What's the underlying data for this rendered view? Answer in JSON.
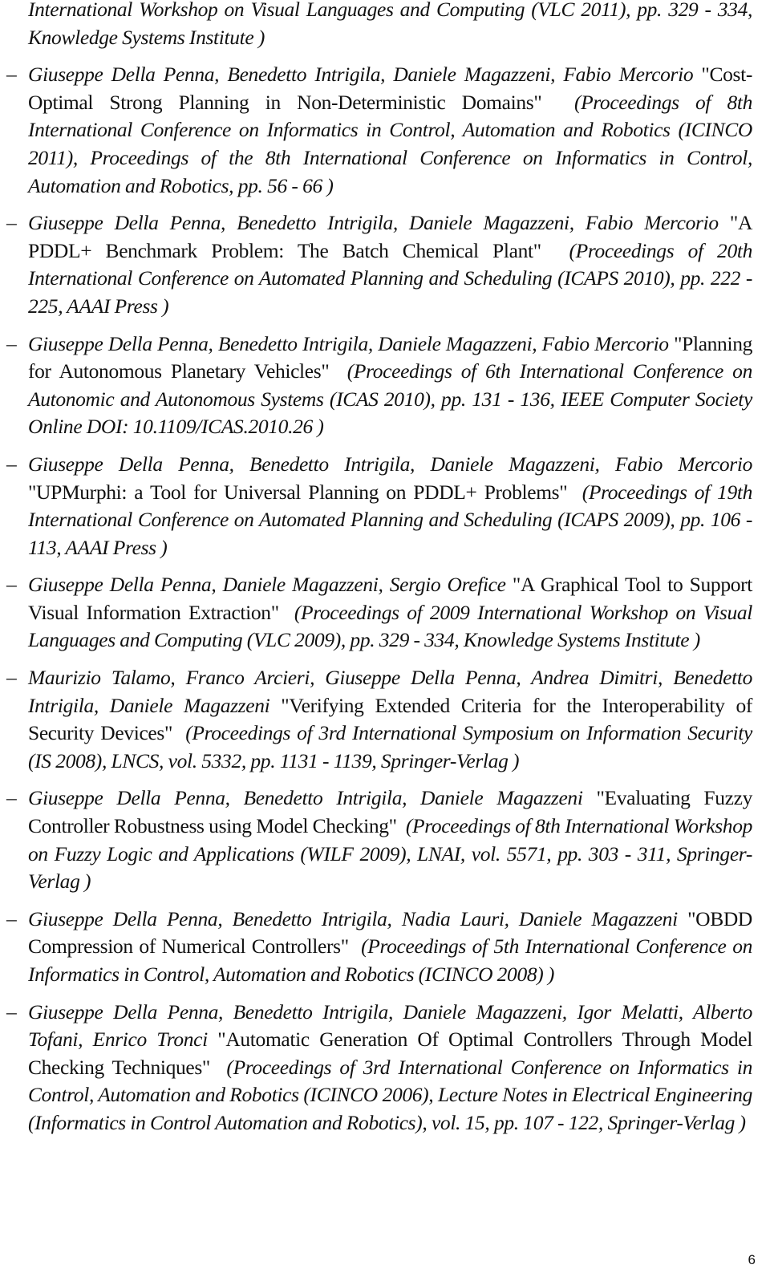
{
  "continuation": {
    "venue": "International Workshop on Visual Languages and Computing (VLC 2011), pp. 329 - 334, Knowledge Systems Institute )"
  },
  "entries": [
    {
      "authors": "Giuseppe Della Penna, Benedetto Intrigila, Daniele Magazzeni, Fabio Mercorio",
      "title": "\"Cost-Optimal Strong Planning in Non-Deterministic Domains\"",
      "venue": "(Proceedings of 8th International Conference on Informatics in Control, Automation and Robotics (ICINCO 2011), Proceedings of the 8th International Conference on Informatics in Control, Automation and Robotics, pp. 56 - 66 )"
    },
    {
      "authors": "Giuseppe Della Penna, Benedetto Intrigila, Daniele Magazzeni, Fabio Mercorio",
      "title": "\"A PDDL+ Benchmark Problem: The Batch Chemical Plant\"",
      "venue": "(Proceedings of 20th International Conference on Automated Planning and Scheduling (ICAPS 2010), pp. 222 - 225, AAAI Press )"
    },
    {
      "authors": "Giuseppe Della Penna, Benedetto Intrigila, Daniele Magazzeni, Fabio Mercorio",
      "title": "\"Planning for Autonomous Planetary Vehicles\"",
      "venue": "(Proceedings of 6th International Conference on Autonomic and Autonomous Systems (ICAS 2010), pp. 131 - 136, IEEE Computer Society Online DOI: 10.1109/ICAS.2010.26 )"
    },
    {
      "authors": "Giuseppe Della Penna, Benedetto Intrigila, Daniele Magazzeni, Fabio Mercorio",
      "title": "\"UPMurphi: a Tool for Universal Planning on PDDL+ Problems\"",
      "venue": "(Proceedings of 19th International Conference on Automated Planning and Scheduling (ICAPS 2009), pp. 106 - 113, AAAI Press )"
    },
    {
      "authors": "Giuseppe Della Penna, Daniele Magazzeni, Sergio Orefice",
      "title": "\"A Graphical Tool to Support Visual Information Extraction\"",
      "venue": "(Proceedings of 2009 International Workshop on Visual Languages and Computing (VLC 2009), pp. 329 - 334, Knowledge Systems Institute )"
    },
    {
      "authors": "Maurizio Talamo, Franco Arcieri, Giuseppe Della Penna, Andrea Dimitri, Benedetto Intrigila, Daniele Magazzeni",
      "title": "\"Verifying Extended Criteria for the Interoperability of Security Devices\"",
      "venue": "(Proceedings of 3rd International Symposium on Information Security (IS 2008), LNCS, vol. 5332, pp. 1131 - 1139, Springer-Verlag )"
    },
    {
      "authors": "Giuseppe Della Penna, Benedetto Intrigila, Daniele Magazzeni",
      "title": "\"Evaluating Fuzzy Controller Robustness using Model Checking\"",
      "venue": "(Proceedings of 8th International Workshop on Fuzzy Logic and Applications (WILF 2009), LNAI, vol. 5571, pp. 303 - 311, Springer-Verlag )"
    },
    {
      "authors": "Giuseppe Della Penna, Benedetto Intrigila, Nadia Lauri, Daniele Magazzeni",
      "title": "\"OBDD Compression of Numerical Controllers\"",
      "venue": "(Proceedings of 5th International Conference on Informatics in Control, Automation and Robotics (ICINCO 2008) )"
    },
    {
      "authors": "Giuseppe Della Penna, Benedetto Intrigila, Daniele Magazzeni, Igor Melatti, Alberto Tofani, Enrico Tronci",
      "title": "\"Automatic Generation Of Optimal Controllers Through Model Checking Techniques\"",
      "venue": "(Proceedings of 3rd International Conference on Informatics in Control, Automation and Robotics (ICINCO 2006), Lecture Notes in Electrical Engineering (Informatics in Control Automation and Robotics), vol. 15, pp. 107 - 122, Springer-Verlag )"
    }
  ],
  "bullet_glyph": "–",
  "page_number": "6"
}
